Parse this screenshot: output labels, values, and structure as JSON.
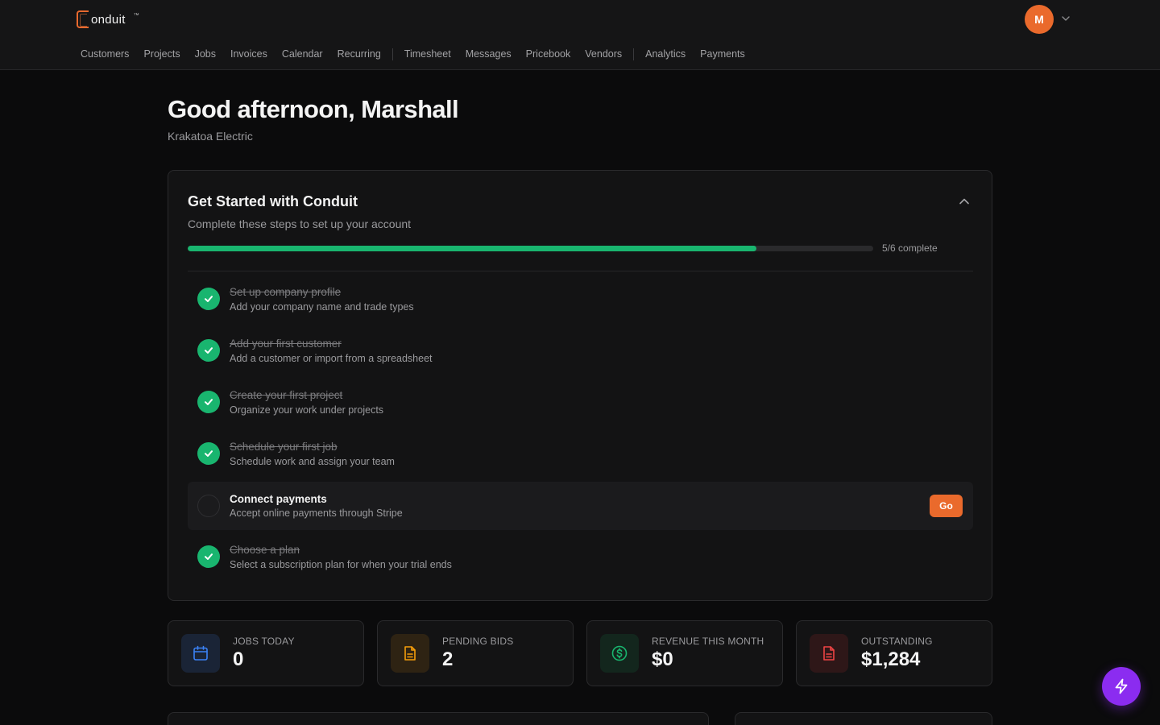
{
  "app": {
    "logo_text": "onduit",
    "trademark": "™",
    "user_initial": "M"
  },
  "nav": {
    "group1": [
      "Customers",
      "Projects",
      "Jobs",
      "Invoices",
      "Calendar",
      "Recurring"
    ],
    "group2": [
      "Timesheet",
      "Messages",
      "Pricebook",
      "Vendors"
    ],
    "group3": [
      "Analytics",
      "Payments"
    ]
  },
  "greeting": {
    "title": "Good afternoon, Marshall",
    "company": "Krakatoa Electric"
  },
  "onboarding": {
    "title": "Get Started with Conduit",
    "subtitle": "Complete these steps to set up your account",
    "progress_fraction": 0.83,
    "progress_text": "5/6 complete",
    "go_label": "Go",
    "steps": [
      {
        "title": "Set up company profile",
        "desc": "Add your company name and trade types",
        "done": true
      },
      {
        "title": "Add your first customer",
        "desc": "Add a customer or import from a spreadsheet",
        "done": true
      },
      {
        "title": "Create your first project",
        "desc": "Organize your work under projects",
        "done": true
      },
      {
        "title": "Schedule your first job",
        "desc": "Schedule work and assign your team",
        "done": true
      },
      {
        "title": "Connect payments",
        "desc": "Accept online payments through Stripe",
        "done": false
      },
      {
        "title": "Choose a plan",
        "desc": "Select a subscription plan for when your trial ends",
        "done": true
      }
    ]
  },
  "stats": [
    {
      "label": "JOBS TODAY",
      "value": "0",
      "icon": "calendar-icon",
      "color": "#3b82f6"
    },
    {
      "label": "PENDING BIDS",
      "value": "2",
      "icon": "document-icon",
      "color": "#f59e0b"
    },
    {
      "label": "REVENUE THIS MONTH",
      "value": "$0",
      "icon": "dollar-icon",
      "color": "#19b56f"
    },
    {
      "label": "OUTSTANDING",
      "value": "$1,284",
      "icon": "document-icon",
      "color": "#ef4444"
    }
  ],
  "colors": {
    "accent": "#ea6a2c",
    "success": "#19b56f",
    "fab": "#8b2cf0"
  }
}
